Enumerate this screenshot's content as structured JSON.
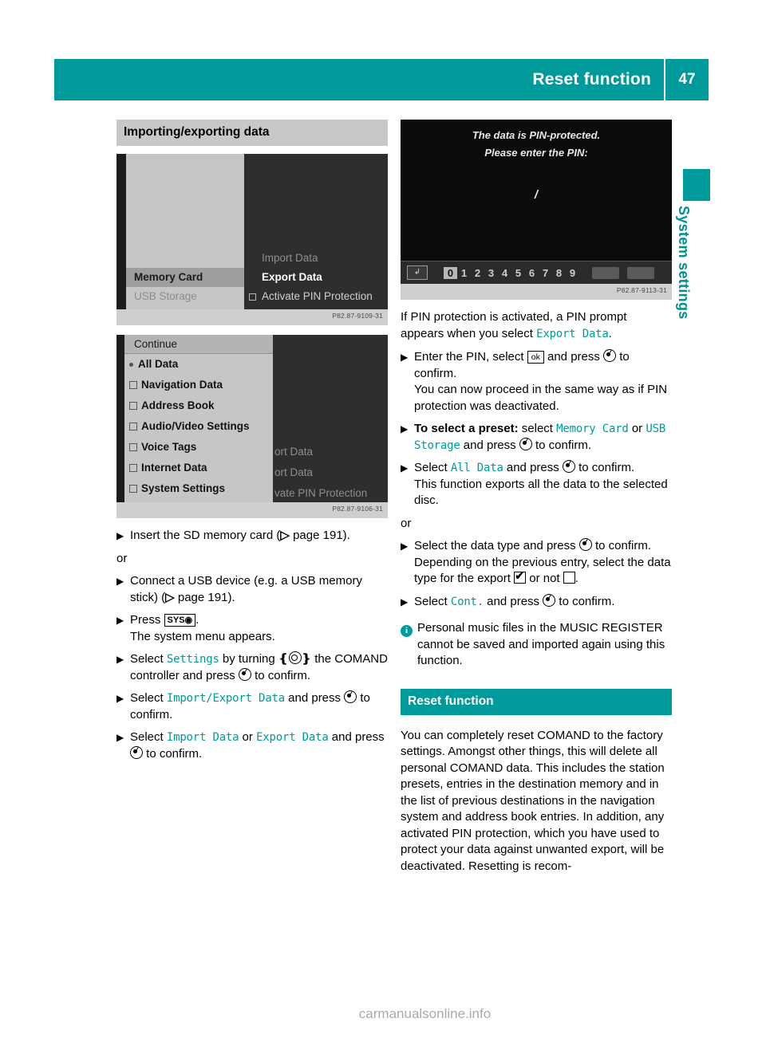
{
  "header": {
    "title": "Reset function",
    "page_number": "47",
    "accent_color": "#009a9a"
  },
  "side_tab": {
    "label": "System settings"
  },
  "left_column": {
    "section_heading": "Importing/exporting data",
    "figure1": {
      "caption_code": "P82.87-9109-31",
      "left_menu": [
        {
          "label": "Memory Card",
          "state": "selected"
        },
        {
          "label": "USB Storage",
          "state": "dimmed"
        }
      ],
      "right_menu": [
        {
          "label": "Import Data",
          "state": "dimmed"
        },
        {
          "label": "Export Data",
          "state": "highlighted"
        },
        {
          "label": "Activate PIN Protection",
          "state": "checkbox"
        }
      ]
    },
    "figure2": {
      "caption_code": "P82.87-9106-31",
      "header_item": "Continue",
      "list": [
        {
          "label": "All Data",
          "marker": "dot"
        },
        {
          "label": "Navigation Data",
          "marker": "check"
        },
        {
          "label": "Address Book",
          "marker": "check"
        },
        {
          "label": "Audio/Video Settings",
          "marker": "check"
        },
        {
          "label": "Voice Tags",
          "marker": "check"
        },
        {
          "label": "Internet Data",
          "marker": "check"
        },
        {
          "label": "System Settings",
          "marker": "check"
        }
      ],
      "background_items": [
        "ort Data",
        "ort Data",
        "vate PIN Protection"
      ]
    },
    "steps": {
      "s1": "Insert the SD memory card (",
      "s1_page": "page 191",
      "s1_end": ").",
      "or1": "or",
      "s2_a": "Connect a USB device (e.g. a USB memory stick) (",
      "s2_page": "page 191",
      "s2_end": ").",
      "s3_a": "Press ",
      "s3_key": "SYS",
      "s3_end": ".",
      "s3_sub": "The system menu appears.",
      "s4_a": "Select ",
      "s4_cmd": "Settings",
      "s4_b": " by turning ",
      "s4_c": " the COMAND controller and press ",
      "s4_d": " to confirm.",
      "s5_a": "Select ",
      "s5_cmd": "Import/Export Data",
      "s5_b": " and press ",
      "s5_c": " to confirm.",
      "s6_a": "Select ",
      "s6_cmd1": "Import Data",
      "s6_b": " or ",
      "s6_cmd2": "Export Data",
      "s6_c": " and press ",
      "s6_d": " to confirm."
    }
  },
  "right_column": {
    "figure3": {
      "caption_code": "P82.87-9113-31",
      "line1": "The data is PIN-protected.",
      "line2": "Please enter the PIN:",
      "cursor": "/",
      "digits": [
        "0",
        "1",
        "2",
        "3",
        "4",
        "5",
        "6",
        "7",
        "8",
        "9"
      ],
      "selected_digit": "0"
    },
    "intro_a": "If PIN protection is activated, a PIN prompt appears when you select ",
    "intro_cmd": "Export Data",
    "intro_b": ".",
    "steps": {
      "p1_a": "Enter the PIN, select ",
      "p1_ok": "ok",
      "p1_b": " and press ",
      "p1_c": " to confirm.",
      "p1_sub": "You can now proceed in the same way as if PIN protection was deactivated.",
      "p2_bold": "To select a preset:",
      "p2_a": " select ",
      "p2_cmd1": "Memory Card",
      "p2_b": " or ",
      "p2_cmd2": "USB Storage",
      "p2_c": " and press ",
      "p2_d": " to confirm.",
      "p3_a": "Select ",
      "p3_cmd": "All Data",
      "p3_b": " and press ",
      "p3_c": " to confirm.",
      "p3_sub": "This function exports all the data to the selected disc.",
      "or2": "or",
      "p4_a": "Select the data type and press ",
      "p4_b": " to confirm.",
      "p4_sub_a": "Depending on the previous entry, select the data type for the export ",
      "p4_sub_b": " or not ",
      "p4_sub_c": ".",
      "p5_a": "Select ",
      "p5_cmd": "Cont.",
      "p5_b": " and press ",
      "p5_c": " to confirm."
    },
    "note": "Personal music files in the MUSIC REGISTER cannot be saved and imported again using this function.",
    "reset_section": {
      "heading": "Reset function",
      "body": "You can completely reset COMAND to the factory settings. Amongst other things, this will delete all personal COMAND data. This includes the station presets, entries in the destination memory and in the list of previous destinations in the navigation system and address book entries. In addition, any activated PIN protection, which you have used to protect your data against unwanted export, will be deactivated. Resetting is recom-"
    }
  },
  "watermark": "carmanualsonline.info"
}
